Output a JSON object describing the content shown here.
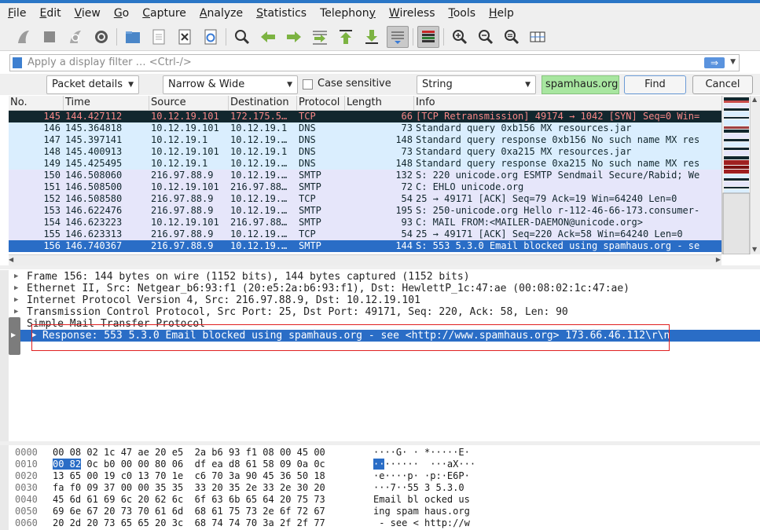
{
  "menu": [
    "File",
    "Edit",
    "View",
    "Go",
    "Capture",
    "Analyze",
    "Statistics",
    "Telephony",
    "Wireless",
    "Tools",
    "Help"
  ],
  "menu_accel": [
    "F",
    "E",
    "V",
    "G",
    "C",
    "A",
    "S",
    "y",
    "W",
    "T",
    "H"
  ],
  "toolbar_icons": [
    "shark-fin-start-icon",
    "stop-square-icon",
    "shark-fin-restart-icon",
    "gear-options-icon",
    "open-folder-icon",
    "file-icon",
    "close-file-icon",
    "reload-icon",
    "search-magnifier-icon",
    "back-arrow-icon",
    "forward-arrow-icon",
    "goto-packet-icon",
    "first-packet-icon",
    "last-packet-icon",
    "autoscroll-icon",
    "colorize-icon",
    "zoom-in-icon",
    "zoom-out-icon",
    "zoom-normal-icon",
    "resize-columns-icon"
  ],
  "filter": {
    "placeholder": "Apply a display filter … <Ctrl-/>",
    "apply_icon": "⇒"
  },
  "find": {
    "search_in": "Packet details",
    "char_width": "Narrow & Wide",
    "case_label": "Case sensitive",
    "type": "String",
    "value": "spamhaus.org",
    "find_label": "Find",
    "cancel_label": "Cancel"
  },
  "packet_columns": [
    "No.",
    "Time",
    "Source",
    "Destination",
    "Protocol",
    "Length",
    "Info"
  ],
  "packets": [
    {
      "no": "145",
      "time": "144.427112",
      "src": "10.12.19.101",
      "dst": "172.175.5…",
      "proto": "TCP",
      "len": "66",
      "info": "[TCP Retransmission] 49174 → 1042 [SYN] Seq=0 Win=",
      "style": "bad"
    },
    {
      "no": "146",
      "time": "145.364818",
      "src": "10.12.19.101",
      "dst": "10.12.19.1",
      "proto": "DNS",
      "len": "73",
      "info": "Standard query 0xb156 MX resources.jar",
      "style": "dns"
    },
    {
      "no": "147",
      "time": "145.397141",
      "src": "10.12.19.1",
      "dst": "10.12.19.…",
      "proto": "DNS",
      "len": "148",
      "info": "Standard query response 0xb156 No such name MX res",
      "style": "dns"
    },
    {
      "no": "148",
      "time": "145.400913",
      "src": "10.12.19.101",
      "dst": "10.12.19.1",
      "proto": "DNS",
      "len": "73",
      "info": "Standard query 0xa215 MX resources.jar",
      "style": "dns"
    },
    {
      "no": "149",
      "time": "145.425495",
      "src": "10.12.19.1",
      "dst": "10.12.19.…",
      "proto": "DNS",
      "len": "148",
      "info": "Standard query response 0xa215 No such name MX res",
      "style": "dns"
    },
    {
      "no": "150",
      "time": "146.508060",
      "src": "216.97.88.9",
      "dst": "10.12.19.…",
      "proto": "SMTP",
      "len": "132",
      "info": "S: 220 unicode.org ESMTP Sendmail Secure/Rabid; We",
      "style": "smtp"
    },
    {
      "no": "151",
      "time": "146.508500",
      "src": "10.12.19.101",
      "dst": "216.97.88…",
      "proto": "SMTP",
      "len": "72",
      "info": "C: EHLO unicode.org",
      "style": "smtp"
    },
    {
      "no": "152",
      "time": "146.508580",
      "src": "216.97.88.9",
      "dst": "10.12.19.…",
      "proto": "TCP",
      "len": "54",
      "info": "25 → 49171 [ACK] Seq=79 Ack=19 Win=64240 Len=0",
      "style": "smtp"
    },
    {
      "no": "153",
      "time": "146.622476",
      "src": "216.97.88.9",
      "dst": "10.12.19.…",
      "proto": "SMTP",
      "len": "195",
      "info": "S: 250-unicode.org Hello r-112-46-66-173.consumer-",
      "style": "smtp"
    },
    {
      "no": "154",
      "time": "146.623223",
      "src": "10.12.19.101",
      "dst": "216.97.88…",
      "proto": "SMTP",
      "len": "93",
      "info": "C: MAIL FROM:<MAILER-DAEMON@unicode.org>",
      "style": "smtp"
    },
    {
      "no": "155",
      "time": "146.623313",
      "src": "216.97.88.9",
      "dst": "10.12.19.…",
      "proto": "TCP",
      "len": "54",
      "info": "25 → 49171 [ACK] Seq=220 Ack=58 Win=64240 Len=0",
      "style": "smtp"
    },
    {
      "no": "156",
      "time": "146.740367",
      "src": "216.97.88.9",
      "dst": "10.12.19.…",
      "proto": "SMTP",
      "len": "144",
      "info": "S: 553 5.3.0 Email blocked using spamhaus.org - se",
      "style": "sel"
    }
  ],
  "details": [
    {
      "text": "Frame 156: 144 bytes on wire (1152 bits), 144 bytes captured (1152 bits)",
      "expand": "▶"
    },
    {
      "text": "Ethernet II, Src: Netgear_b6:93:f1 (20:e5:2a:b6:93:f1), Dst: HewlettP_1c:47:ae (00:08:02:1c:47:ae)",
      "expand": "▶"
    },
    {
      "text": "Internet Protocol Version 4, Src: 216.97.88.9, Dst: 10.12.19.101",
      "expand": "▶"
    },
    {
      "text": "Transmission Control Protocol, Src Port: 25, Dst Port: 49171, Seq: 220, Ack: 58, Len: 90",
      "expand": "▶"
    },
    {
      "text": "Simple Mail Transfer Protocol",
      "expand": "▼"
    },
    {
      "text": "Response: 553 5.3.0 Email blocked using spamhaus.org - see <http://www.spamhaus.org> 173.66.46.112\\r\\n",
      "expand": "▶"
    }
  ],
  "bytes": [
    {
      "off": "0000",
      "hex": "00 08 02 1c 47 ae 20 e5  2a b6 93 f1 08 00 45 00",
      "asc": "····G· · *·····E·"
    },
    {
      "off": "0010",
      "hex_hl": "00 82",
      "hex": " 0c b0 00 00 80 06  df ea d8 61 58 09 0a 0c",
      "asc_hl": "··",
      "asc": "······  ···aX···"
    },
    {
      "off": "0020",
      "hex": "13 65 00 19 c0 13 70 1e  c6 70 3a 90 45 36 50 18",
      "asc": "·e····p· ·p:·E6P·"
    },
    {
      "off": "0030",
      "hex": "fa f0 09 37 00 00 35 35  33 20 35 2e 33 2e 30 20",
      "asc": "···7··55 3 5.3.0"
    },
    {
      "off": "0040",
      "hex": "45 6d 61 69 6c 20 62 6c  6f 63 6b 65 64 20 75 73",
      "asc": "Email bl ocked us"
    },
    {
      "off": "0050",
      "hex": "69 6e 67 20 73 70 61 6d  68 61 75 73 2e 6f 72 67",
      "asc": "ing spam haus.org"
    },
    {
      "off": "0060",
      "hex": "20 2d 20 73 65 65 20 3c  68 74 74 70 3a 2f 2f 77",
      "asc": " - see < http://w"
    }
  ],
  "colors": {
    "selected": "#2a6dc6",
    "dns_row": "#daeefe",
    "smtp_row": "#e6e6fa",
    "bad_row": "#12272e",
    "highlight_box": "#e02020"
  }
}
